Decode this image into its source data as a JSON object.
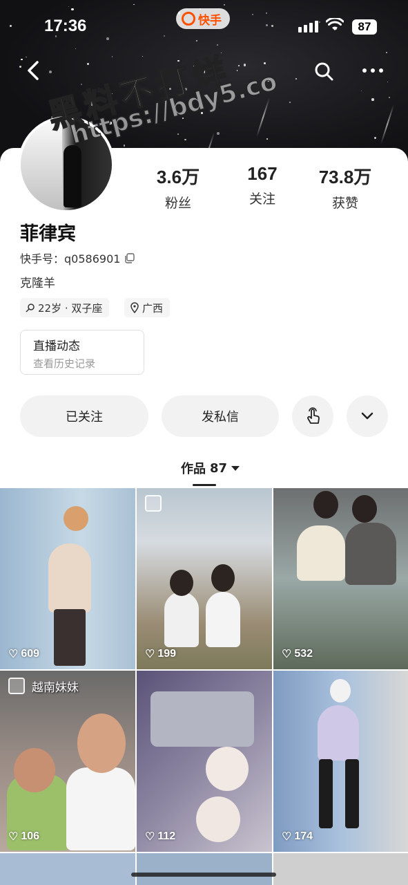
{
  "status_bar": {
    "time": "17:36",
    "battery": "87",
    "app_name": "快手"
  },
  "nav": {
    "back": "back-arrow-icon",
    "search": "search-icon",
    "more": "more-icon"
  },
  "watermark": {
    "line1": "黑料不打烊",
    "line2": "https://bdy5.co"
  },
  "profile": {
    "name": "菲律宾",
    "kuaishou_id_label": "快手号：",
    "kuaishou_id": "q0586901",
    "bio": "克隆羊",
    "tags": [
      {
        "icon": "gender-male-icon",
        "label": "22岁 · 双子座"
      },
      {
        "icon": "location-icon",
        "label": "广西"
      }
    ]
  },
  "stats": [
    {
      "value": "3.6万",
      "label": "粉丝"
    },
    {
      "value": "167",
      "label": "关注"
    },
    {
      "value": "73.8万",
      "label": "获赞"
    }
  ],
  "live": {
    "title": "直播动态",
    "subtitle": "查看历史记录"
  },
  "actions": {
    "following": "已关注",
    "message": "发私信",
    "poke": "poke-hand-icon",
    "expand": "chevron-down-icon"
  },
  "works_tab": {
    "label": "作品",
    "count": "87"
  },
  "grid": [
    {
      "likes": "609",
      "image_post": false,
      "caption": ""
    },
    {
      "likes": "199",
      "image_post": true,
      "caption": ""
    },
    {
      "likes": "532",
      "image_post": false,
      "caption": ""
    },
    {
      "likes": "106",
      "image_post": true,
      "caption": "越南妹妹"
    },
    {
      "likes": "112",
      "image_post": false,
      "caption": ""
    },
    {
      "likes": "174",
      "image_post": false,
      "caption": ""
    }
  ],
  "colors": {
    "accent": "#ff5000",
    "button_bg": "#f2f2f2",
    "muted_text": "#999999"
  }
}
